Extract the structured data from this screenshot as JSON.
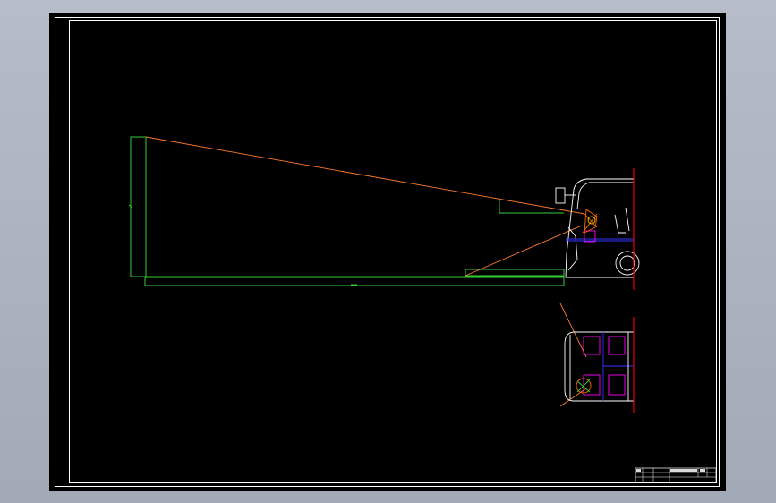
{
  "drawing": {
    "background_color": "#000000",
    "frame_color": "#ffffff",
    "sightline_color": "#ff7b2e",
    "ground_color": "#33cc33",
    "vehicle_outline_color": "#ffffff",
    "seat_color": "#ff00ff",
    "bumper_color": "#ff0000",
    "driver_color": "#ff6600",
    "structure_color": "#3333ff"
  },
  "title_block": {
    "label_1": "",
    "label_2": "",
    "label_3": ""
  }
}
